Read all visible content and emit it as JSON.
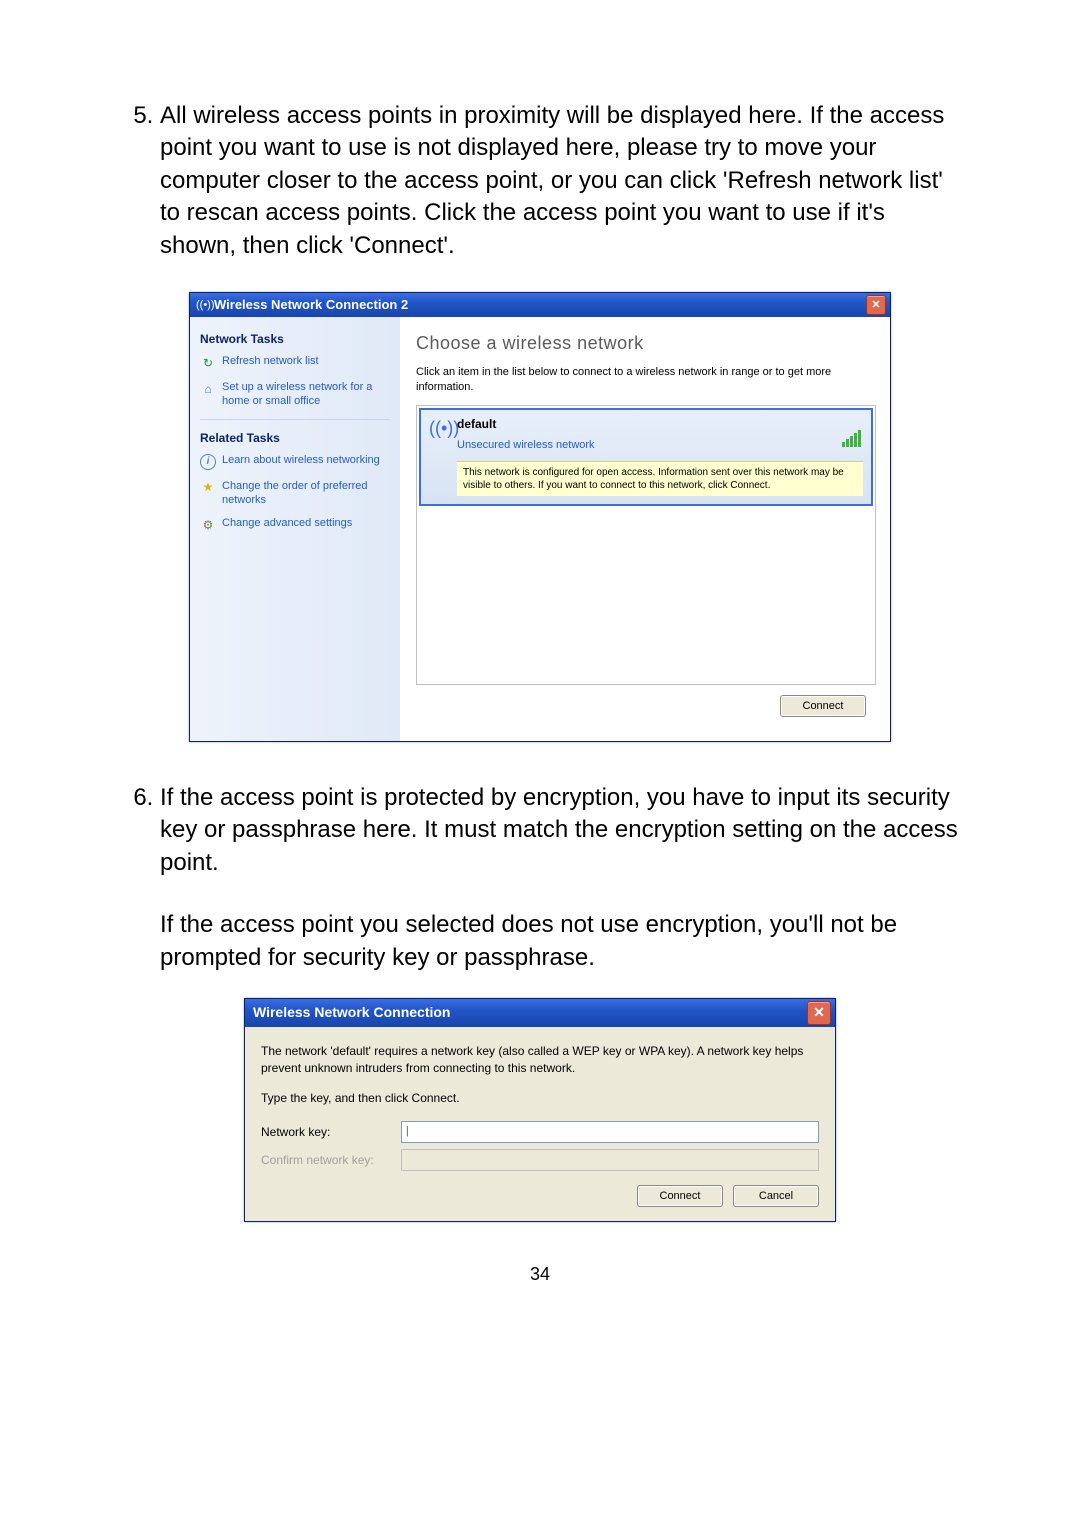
{
  "doc": {
    "step5_number": "5.",
    "step5_text": "All wireless access points in proximity will be displayed here. If the access point you want to use is not displayed here, please try to move your computer closer to the access point, or you can click 'Refresh network list' to rescan access points. Click the access point you want to use if it's shown, then click 'Connect'.",
    "step6_number": "6.",
    "step6_text": "If the access point is protected by encryption, you have to input its security key or passphrase here. It must match the encryption setting on the access point.",
    "step6_para2": "If the access point you selected does not use encryption, you'll not be prompted for security key or passphrase.",
    "page_number": "34"
  },
  "win1": {
    "title": "Wireless Network Connection 2",
    "antenna_glyph": "((•))",
    "sidebar": {
      "network_tasks": "Network Tasks",
      "refresh": "Refresh network list",
      "setup": "Set up a wireless network for a home or small office",
      "related_tasks": "Related Tasks",
      "learn": "Learn about wireless networking",
      "order": "Change the order of preferred networks",
      "advanced": "Change advanced settings"
    },
    "main": {
      "heading": "Choose a wireless network",
      "desc": "Click an item in the list below to connect to a wireless network in range or to get more information.",
      "net_name": "default",
      "net_type": "Unsecured wireless network",
      "warning": "This network is configured for open access. Information sent over this network may be visible to others. If you want to connect to this network, click Connect.",
      "connect": "Connect"
    }
  },
  "win2": {
    "title": "Wireless Network Connection",
    "body_text": "The network 'default' requires a network key (also called a WEP key or WPA key). A network key helps prevent unknown intruders from connecting to this network.",
    "type_key": "Type the key, and then click Connect.",
    "network_key": "Network key:",
    "confirm_key": "Confirm network key:",
    "input_value": "|",
    "connect": "Connect",
    "cancel": "Cancel"
  }
}
